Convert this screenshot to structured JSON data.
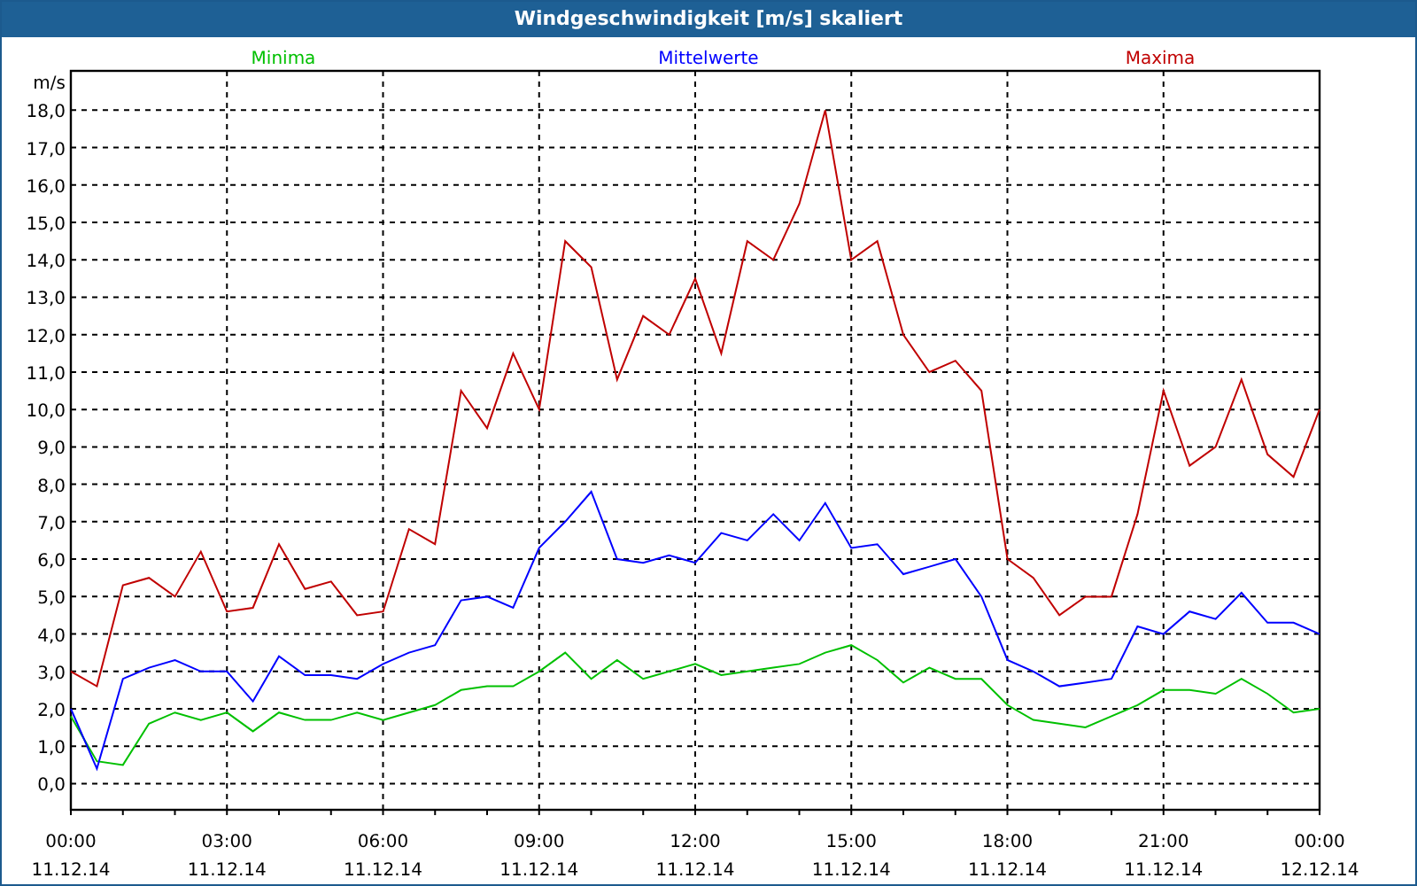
{
  "chart": {
    "chart_data": {
      "type": "line",
      "title": "Windgeschwindigkeit [m/s] skaliert",
      "ylabel": "m/s",
      "grid": true,
      "x": [
        0,
        0.5,
        1,
        1.5,
        2,
        2.5,
        3,
        3.5,
        4,
        4.5,
        5,
        5.5,
        6,
        6.5,
        7,
        7.5,
        8,
        8.5,
        9,
        9.5,
        10,
        10.5,
        11,
        11.5,
        12,
        12.5,
        13,
        13.5,
        14,
        14.5,
        15,
        15.5,
        16,
        16.5,
        17,
        17.5,
        18,
        18.5,
        19,
        19.5,
        20,
        20.5,
        21,
        21.5,
        22,
        22.5,
        23,
        23.5,
        24
      ],
      "series": [
        {
          "name": "Minima",
          "color": "#00c000",
          "values": [
            1.8,
            0.6,
            0.5,
            1.6,
            1.9,
            1.7,
            1.9,
            1.4,
            1.9,
            1.7,
            1.7,
            1.9,
            1.7,
            1.9,
            2.1,
            2.5,
            2.6,
            2.6,
            3.0,
            3.5,
            2.8,
            3.3,
            2.8,
            3.0,
            3.2,
            2.9,
            3.0,
            3.1,
            3.2,
            3.5,
            3.7,
            3.3,
            2.7,
            3.1,
            2.8,
            2.8,
            2.1,
            1.7,
            1.6,
            1.5,
            1.8,
            2.1,
            2.5,
            2.5,
            2.4,
            2.8,
            2.4,
            1.9,
            2.0
          ]
        },
        {
          "name": "Mittelwerte",
          "color": "#0000ff",
          "values": [
            2.0,
            0.4,
            2.8,
            3.1,
            3.3,
            3.0,
            3.0,
            2.2,
            3.4,
            2.9,
            2.9,
            2.8,
            3.2,
            3.5,
            3.7,
            4.9,
            5.0,
            4.7,
            6.3,
            7.0,
            7.8,
            6.0,
            5.9,
            6.1,
            5.9,
            6.7,
            6.5,
            7.2,
            6.5,
            7.5,
            6.3,
            6.4,
            5.6,
            5.8,
            6.0,
            5.0,
            3.3,
            3.0,
            2.6,
            2.7,
            2.8,
            4.2,
            4.0,
            4.6,
            4.4,
            5.1,
            4.3,
            4.3,
            4.0
          ]
        },
        {
          "name": "Maxima",
          "color": "#c00000",
          "values": [
            3.0,
            2.6,
            5.3,
            5.5,
            5.0,
            6.2,
            4.6,
            4.7,
            6.4,
            5.2,
            5.4,
            4.5,
            4.6,
            6.8,
            6.4,
            10.5,
            9.5,
            11.5,
            10.0,
            14.5,
            13.8,
            10.8,
            12.5,
            12.0,
            13.5,
            11.5,
            14.5,
            14.0,
            15.5,
            18.0,
            14.0,
            14.5,
            12.0,
            11.0,
            11.3,
            10.5,
            6.0,
            5.5,
            4.5,
            5.0,
            5.0,
            7.2,
            10.5,
            8.5,
            9.0,
            10.8,
            8.8,
            8.2,
            10.0
          ]
        }
      ],
      "xlim": [
        0,
        24
      ],
      "ylim": [
        -0.7,
        19.05
      ],
      "xticks": [
        {
          "value": 0,
          "label": "00:00"
        },
        {
          "value": 3,
          "label": "03:00"
        },
        {
          "value": 6,
          "label": "06:00"
        },
        {
          "value": 9,
          "label": "09:00"
        },
        {
          "value": 12,
          "label": "12:00"
        },
        {
          "value": 15,
          "label": "15:00"
        },
        {
          "value": 18,
          "label": "18:00"
        },
        {
          "value": 21,
          "label": "21:00"
        },
        {
          "value": 24,
          "label": "00:00"
        }
      ],
      "yticks": [
        {
          "value": 0,
          "label": "0,0"
        },
        {
          "value": 1,
          "label": "1,0"
        },
        {
          "value": 2,
          "label": "2,0"
        },
        {
          "value": 3,
          "label": "3,0"
        },
        {
          "value": 4,
          "label": "4,0"
        },
        {
          "value": 5,
          "label": "5,0"
        },
        {
          "value": 6,
          "label": "6,0"
        },
        {
          "value": 7,
          "label": "7,0"
        },
        {
          "value": 8,
          "label": "8,0"
        },
        {
          "value": 9,
          "label": "9,0"
        },
        {
          "value": 10,
          "label": "10,0"
        },
        {
          "value": 11,
          "label": "11,0"
        },
        {
          "value": 12,
          "label": "12,0"
        },
        {
          "value": 13,
          "label": "13,0"
        },
        {
          "value": 14,
          "label": "14,0"
        },
        {
          "value": 15,
          "label": "15,0"
        },
        {
          "value": 16,
          "label": "16,0"
        },
        {
          "value": 17,
          "label": "17,0"
        },
        {
          "value": 18,
          "label": "18,0"
        }
      ]
    },
    "xtick_dates": [
      "11.12.14",
      "11.12.14",
      "11.12.14",
      "11.12.14",
      "11.12.14",
      "11.12.14",
      "11.12.14",
      "11.12.14",
      "12.12.14"
    ]
  }
}
